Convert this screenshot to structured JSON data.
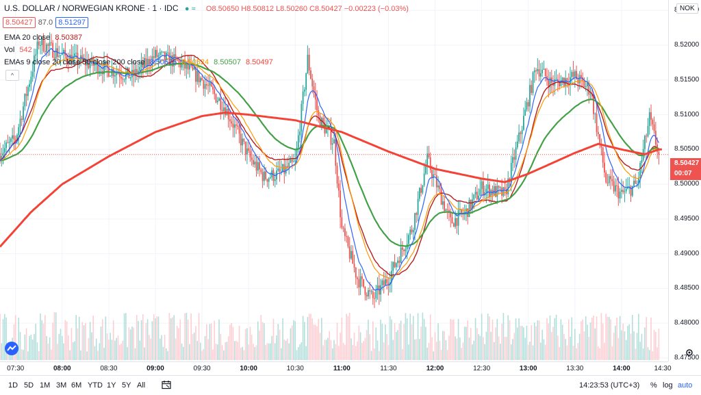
{
  "header": {
    "title": "U.S. DOLLAR / NORWEGIAN KRONE · 1 · IDC",
    "ohlc": "O8.50650 H8.50812 L8.50260 C8.50427 −0.00223 (−0.03%)",
    "bid": "8.50427",
    "spread": "87.0",
    "ask": "8.51297"
  },
  "indicators": [
    {
      "label": "EMA 20 close",
      "values": [
        "8.50387"
      ],
      "colors": [
        "#b71c1c"
      ]
    },
    {
      "label": "Vol",
      "values": [
        "542"
      ],
      "colors": [
        "#ef5350"
      ]
    },
    {
      "label": "EMAs 9 close 20 close 50 close 200 close",
      "values": [
        "8.50675",
        "8.50524",
        "8.50507",
        "8.50497"
      ],
      "colors": [
        "#2962ff",
        "#ff9800",
        "#43a047",
        "#f44336"
      ]
    }
  ],
  "price_scale": {
    "currency": "NOK",
    "last_price": "8.50427",
    "countdown": "00:07"
  },
  "time_axis_extra": "14:30",
  "bottom_bar": {
    "ranges": [
      "1D",
      "5D",
      "1M",
      "3M",
      "6M",
      "YTD",
      "1Y",
      "5Y",
      "All"
    ],
    "clock": "14:23:53 (UTC+3)",
    "options": [
      "%",
      "log",
      "auto"
    ]
  },
  "colors": {
    "up": "#26a69a",
    "down": "#ef5350",
    "ema9": "#2962ff",
    "ema20": "#ff9800",
    "ema50": "#43a047",
    "ema200": "#f44336",
    "ema20_single": "#b71c1c",
    "volume_up": "#b2dfdb",
    "volume_down": "#ffcdd2"
  },
  "chart_data": {
    "type": "candlestick",
    "ylim": [
      8.4745,
      8.5265
    ],
    "y_ticks": [
      8.475,
      8.48,
      8.485,
      8.49,
      8.495,
      8.5,
      8.505,
      8.51,
      8.515,
      8.52,
      8.525
    ],
    "x_ticks": [
      "07:30",
      "08:00",
      "08:30",
      "09:00",
      "09:30",
      "10:00",
      "10:30",
      "11:00",
      "11:30",
      "12:00",
      "12:30",
      "13:00",
      "13:30",
      "14:00"
    ],
    "x_range": [
      "07:20",
      "14:30"
    ],
    "last_close": 8.50427,
    "price_anchors": [
      [
        "07:20",
        8.5045
      ],
      [
        "07:30",
        8.5065
      ],
      [
        "07:45",
        8.5205
      ],
      [
        "08:00",
        8.5185
      ],
      [
        "08:15",
        8.5175
      ],
      [
        "08:30",
        8.5165
      ],
      [
        "08:45",
        8.5155
      ],
      [
        "09:00",
        8.5185
      ],
      [
        "09:15",
        8.5175
      ],
      [
        "09:30",
        8.515
      ],
      [
        "09:45",
        8.511
      ],
      [
        "10:00",
        8.504
      ],
      [
        "10:10",
        8.501
      ],
      [
        "10:20",
        8.5015
      ],
      [
        "10:30",
        8.503
      ],
      [
        "10:38",
        8.518
      ],
      [
        "10:45",
        8.5095
      ],
      [
        "10:55",
        8.506
      ],
      [
        "11:00",
        8.4935
      ],
      [
        "11:10",
        8.4865
      ],
      [
        "11:20",
        8.4835
      ],
      [
        "11:30",
        8.4865
      ],
      [
        "11:45",
        8.4935
      ],
      [
        "11:55",
        8.5035
      ],
      [
        "12:00",
        8.5005
      ],
      [
        "12:10",
        8.4945
      ],
      [
        "12:20",
        8.496
      ],
      [
        "12:30",
        8.4995
      ],
      [
        "12:45",
        8.4985
      ],
      [
        "12:55",
        8.5075
      ],
      [
        "13:05",
        8.517
      ],
      [
        "13:15",
        8.5145
      ],
      [
        "13:30",
        8.5155
      ],
      [
        "13:40",
        8.5135
      ],
      [
        "13:50",
        8.5005
      ],
      [
        "14:00",
        8.4985
      ],
      [
        "14:10",
        8.5
      ],
      [
        "14:18",
        8.5095
      ],
      [
        "14:24",
        8.5043
      ]
    ],
    "ema200_anchors": [
      [
        "07:20",
        8.491
      ],
      [
        "07:40",
        8.496
      ],
      [
        "08:00",
        8.5
      ],
      [
        "08:30",
        8.504
      ],
      [
        "09:00",
        8.5075
      ],
      [
        "09:30",
        8.5098
      ],
      [
        "09:45",
        8.5103
      ],
      [
        "10:00",
        8.51
      ],
      [
        "10:30",
        8.5092
      ],
      [
        "11:00",
        8.5075
      ],
      [
        "11:30",
        8.5047
      ],
      [
        "12:00",
        8.5022
      ],
      [
        "12:30",
        8.5008
      ],
      [
        "12:45",
        8.5003
      ],
      [
        "13:00",
        8.5015
      ],
      [
        "13:30",
        8.5045
      ],
      [
        "13:45",
        8.5058
      ],
      [
        "14:00",
        8.505
      ],
      [
        "14:15",
        8.5043
      ],
      [
        "14:24",
        8.505
      ]
    ],
    "volume_max": 830
  }
}
